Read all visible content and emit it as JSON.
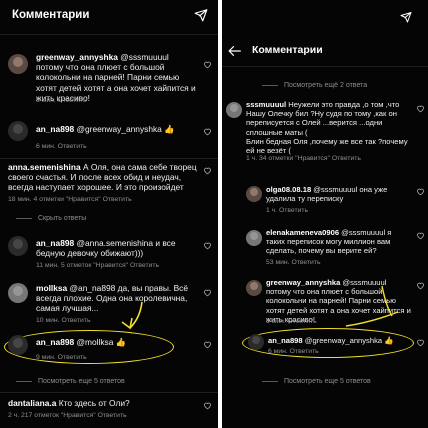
{
  "left": {
    "title": "Комментарии",
    "comments": [
      {
        "user": "greenway_annyshka",
        "text": " @sssmuuuul потому что она плюет с большой колокольни на парней! Парни семью хотят детей хотят а она хочет хайпится и жить красиво!",
        "meta": "5 мин.   Ответить"
      },
      {
        "user": "an_na898",
        "text": " @greenway_annyshka 👍",
        "meta": "6 мин.   Ответить"
      },
      {
        "user": "anna.semenishina",
        "text": " А Оля, она сама себе творец своего счастья. И после всех обид и неудач, всегда наступает хорошее. И это произойдет",
        "meta": "18 мин.   4 отметки \"Нравится\"   Ответить"
      },
      {
        "user": "an_na898",
        "text": " @anna.semenishina и все бедную девочку обижают)))",
        "meta": "11 мин.   5 отметок \"Нравится\"   Ответить"
      },
      {
        "user": "mollksa",
        "text": " @an_na898 да, вы правы. Всё всегда плохие. Одна она королевична, самая лучшая...",
        "meta": "10 мин.   Ответить"
      },
      {
        "user": "an_na898",
        "text": " @mollksa 👍",
        "meta": "9 мин.   Ответить"
      },
      {
        "user": "dantaliana.a",
        "text": " Кто здесь от Оли?",
        "meta": "2 ч.   217 отметок \"Нравится\"   Ответить"
      }
    ],
    "toggles": [
      "Скрыть ответы",
      "Посмотреть еще 5 ответов"
    ]
  },
  "right": {
    "title": "Комментарии",
    "comments": [
      {
        "user": "sssmuuuul",
        "text": " Неужели это правда ,о том ,что Нашу Олечку бил ?Ну судя по тому ,как он переписуется с Олей ...верится ...одни сплошные маты (\nБлин бедная Оля ,почему же все так ?почему ей не везёт (",
        "meta": "1 ч.   34 отметки \"Нравится\"   Ответить"
      },
      {
        "user": "olga08.08.18",
        "text": " @sssmuuuul она уже удалила ту переписку",
        "meta": "1 ч.   Ответить"
      },
      {
        "user": "elenakameneva0906",
        "text": " @sssmuuuul я таких переписок могу миллион вам сделать, почему вы верите ей?",
        "meta": "53 мин.   Ответить"
      },
      {
        "user": "greenway_annyshka",
        "text": " @sssmuuuul потому что она плюет с большой колокольни на парней! Парни семью хотят детей хотят а она хочет хайпится и жить красиво!",
        "meta": "5 мин.   Ответить"
      },
      {
        "user": "an_na898",
        "text": " @greenway_annyshka 👍",
        "meta": "6 мин.   Ответить"
      }
    ],
    "toggles": [
      "Посмотреть ещё 2 ответа",
      "Посмотреть еще 5 ответов"
    ]
  },
  "icons": {
    "send": "send-icon",
    "heart": "heart-icon",
    "back": "back-arrow-icon"
  },
  "colors": {
    "bg": "#050505",
    "text": "#f2f2f2",
    "meta": "#8e8e8e",
    "highlight": "#f4df2a"
  }
}
